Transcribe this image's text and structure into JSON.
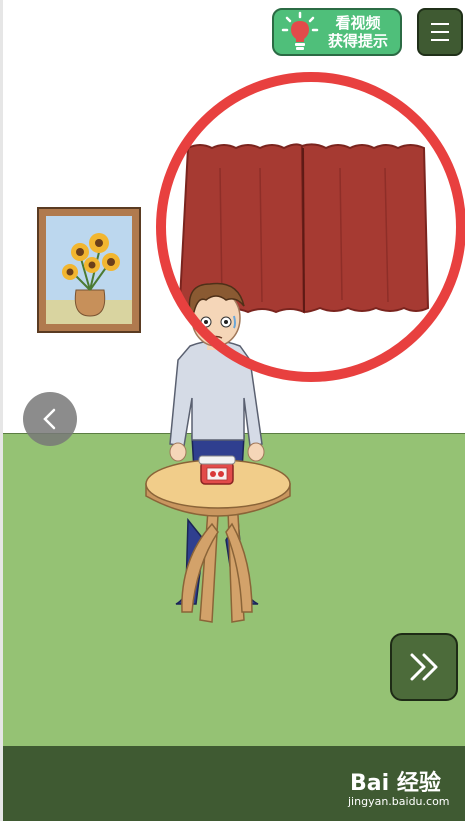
{
  "hud": {
    "hint_line1": "看视频",
    "hint_line2": "获得提示",
    "hint_icon": "lightbulb-icon",
    "menu_icon": "hamburger-menu-icon",
    "back_icon": "chevron-left-icon",
    "next_icon": "double-chevron-right-icon"
  },
  "watermark": {
    "logo": "Bai 经验",
    "url": "jingyan.baidu.com"
  },
  "colors": {
    "hint_green": "#4fbf7a",
    "dark_green": "#3f5a32",
    "floor": "#95c274",
    "curtain": "#a63a32",
    "highlight_circle": "#e8403f"
  }
}
